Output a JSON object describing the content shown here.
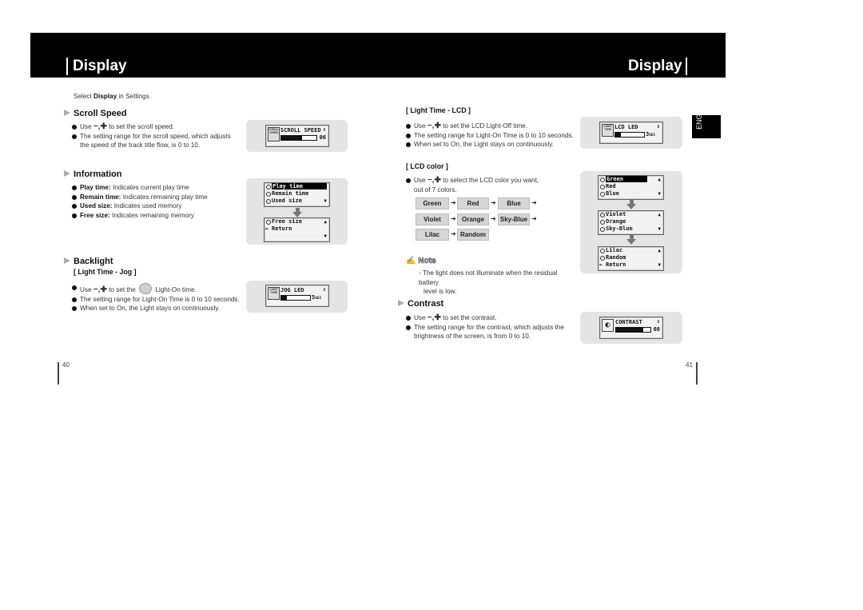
{
  "header": {
    "left_title": "Display",
    "right_title": "Display"
  },
  "intro": {
    "pre": "Select ",
    "bold": "Display",
    "post": " in Settings."
  },
  "scroll_speed": {
    "title": "Scroll Speed",
    "bullets": [
      {
        "pre": "Use ",
        "keys": "−,✚",
        "post": " to set the scroll speed."
      },
      {
        "text": "The setting range for the scroll speed, which adjusts the speed of the track title flow, is  0 to 10."
      }
    ],
    "lcd": {
      "label": "SCROLL SPEED",
      "icon_text": "SCROLL SPEED",
      "value": "06",
      "level_pct": 60
    }
  },
  "information": {
    "title": "Information",
    "bullets": [
      {
        "term": "Play time:",
        "desc": " Indicates current play time"
      },
      {
        "term": "Remain time:",
        "desc": " Indicates remaining play time"
      },
      {
        "term": "Used size:",
        "desc": " Indicates used memory"
      },
      {
        "term": "Free size:",
        "desc": " Indicates remaining memory"
      }
    ],
    "screen1": [
      "Play time",
      "Remain time",
      "Used size"
    ],
    "screen2": [
      "Free size",
      "Return"
    ]
  },
  "backlight": {
    "title": "Backlight",
    "jog_title": "[ Light Time - Jog ]",
    "bullets": [
      {
        "pre": "Use ",
        "keys": "−,✚",
        "mid": " to set the ",
        "post": " Light-On time."
      },
      {
        "text": "The setting range for Light-On Time is 0 to 10 seconds."
      },
      {
        "text": "When set to On, the Light stays on continuously."
      }
    ],
    "lcd": {
      "label": "JOG LED",
      "icon_text": "LIGHT TIME",
      "value": "5",
      "unit": "SEC",
      "level_pct": 20
    }
  },
  "light_lcd": {
    "title": "[ Light Time - LCD ]",
    "bullets": [
      {
        "pre": "Use ",
        "keys": "−,✚",
        "post": " to set the LCD Light-Off time."
      },
      {
        "text": "The setting range for Light-On Time is 0 to 10 seconds."
      },
      {
        "text": "When set to On, the Light stays on continuously."
      }
    ],
    "lcd": {
      "label": "LCD LED",
      "icon_text": "LIGHT TIME",
      "value": "3",
      "unit": "SEC",
      "level_pct": 20
    }
  },
  "lcd_color": {
    "title": "[ LCD color ]",
    "bullet": {
      "pre": "Use ",
      "keys": "−,✚",
      "post": " to select the LCD color you want,",
      "line2": "out of 7 colors."
    },
    "chips": [
      [
        "Green",
        "Red",
        "Blue"
      ],
      [
        "Violet",
        "Orange",
        "Sky-Blue"
      ],
      [
        "Lilac",
        "Random"
      ]
    ],
    "screen1": [
      "Green",
      "Red",
      "Blue"
    ],
    "screen2": [
      "Violet",
      "Orange",
      "Sky-Blue"
    ],
    "screen3": [
      "Lilac",
      "Random",
      "Return"
    ]
  },
  "note": {
    "label": "Note",
    "text": "- The light does not illuminate when the residual battery",
    "text2": "level is low."
  },
  "contrast": {
    "title": "Contrast",
    "bullets": [
      {
        "pre": "Use ",
        "keys": "−,✚",
        "post": " to set the contrast."
      },
      {
        "text": "The setting range for the contrast, which adjusts the brightness of the screen, is from 0 to 10."
      }
    ],
    "lcd": {
      "label": "CONTRAST",
      "value": "08",
      "level_pct": 80
    }
  },
  "side_tab": "ENG",
  "page_left": "40",
  "page_right": "41"
}
